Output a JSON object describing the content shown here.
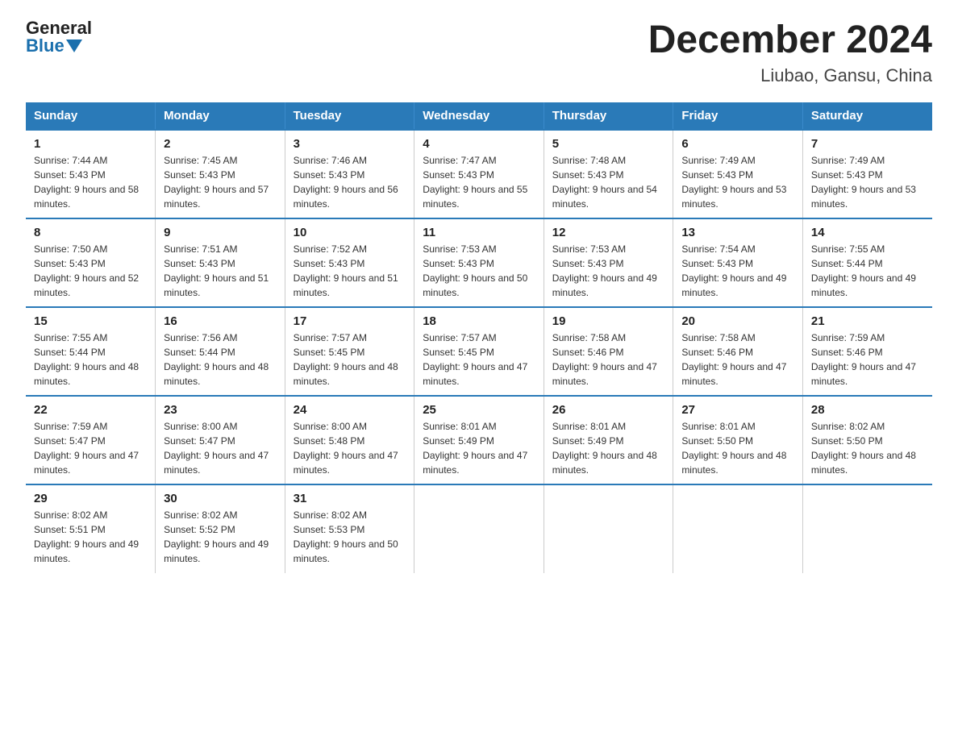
{
  "header": {
    "logo_general": "General",
    "logo_blue": "Blue",
    "month_title": "December 2024",
    "location": "Liubao, Gansu, China"
  },
  "weekdays": [
    "Sunday",
    "Monday",
    "Tuesday",
    "Wednesday",
    "Thursday",
    "Friday",
    "Saturday"
  ],
  "weeks": [
    [
      {
        "day": "1",
        "sunrise": "7:44 AM",
        "sunset": "5:43 PM",
        "daylight": "9 hours and 58 minutes."
      },
      {
        "day": "2",
        "sunrise": "7:45 AM",
        "sunset": "5:43 PM",
        "daylight": "9 hours and 57 minutes."
      },
      {
        "day": "3",
        "sunrise": "7:46 AM",
        "sunset": "5:43 PM",
        "daylight": "9 hours and 56 minutes."
      },
      {
        "day": "4",
        "sunrise": "7:47 AM",
        "sunset": "5:43 PM",
        "daylight": "9 hours and 55 minutes."
      },
      {
        "day": "5",
        "sunrise": "7:48 AM",
        "sunset": "5:43 PM",
        "daylight": "9 hours and 54 minutes."
      },
      {
        "day": "6",
        "sunrise": "7:49 AM",
        "sunset": "5:43 PM",
        "daylight": "9 hours and 53 minutes."
      },
      {
        "day": "7",
        "sunrise": "7:49 AM",
        "sunset": "5:43 PM",
        "daylight": "9 hours and 53 minutes."
      }
    ],
    [
      {
        "day": "8",
        "sunrise": "7:50 AM",
        "sunset": "5:43 PM",
        "daylight": "9 hours and 52 minutes."
      },
      {
        "day": "9",
        "sunrise": "7:51 AM",
        "sunset": "5:43 PM",
        "daylight": "9 hours and 51 minutes."
      },
      {
        "day": "10",
        "sunrise": "7:52 AM",
        "sunset": "5:43 PM",
        "daylight": "9 hours and 51 minutes."
      },
      {
        "day": "11",
        "sunrise": "7:53 AM",
        "sunset": "5:43 PM",
        "daylight": "9 hours and 50 minutes."
      },
      {
        "day": "12",
        "sunrise": "7:53 AM",
        "sunset": "5:43 PM",
        "daylight": "9 hours and 49 minutes."
      },
      {
        "day": "13",
        "sunrise": "7:54 AM",
        "sunset": "5:43 PM",
        "daylight": "9 hours and 49 minutes."
      },
      {
        "day": "14",
        "sunrise": "7:55 AM",
        "sunset": "5:44 PM",
        "daylight": "9 hours and 49 minutes."
      }
    ],
    [
      {
        "day": "15",
        "sunrise": "7:55 AM",
        "sunset": "5:44 PM",
        "daylight": "9 hours and 48 minutes."
      },
      {
        "day": "16",
        "sunrise": "7:56 AM",
        "sunset": "5:44 PM",
        "daylight": "9 hours and 48 minutes."
      },
      {
        "day": "17",
        "sunrise": "7:57 AM",
        "sunset": "5:45 PM",
        "daylight": "9 hours and 48 minutes."
      },
      {
        "day": "18",
        "sunrise": "7:57 AM",
        "sunset": "5:45 PM",
        "daylight": "9 hours and 47 minutes."
      },
      {
        "day": "19",
        "sunrise": "7:58 AM",
        "sunset": "5:46 PM",
        "daylight": "9 hours and 47 minutes."
      },
      {
        "day": "20",
        "sunrise": "7:58 AM",
        "sunset": "5:46 PM",
        "daylight": "9 hours and 47 minutes."
      },
      {
        "day": "21",
        "sunrise": "7:59 AM",
        "sunset": "5:46 PM",
        "daylight": "9 hours and 47 minutes."
      }
    ],
    [
      {
        "day": "22",
        "sunrise": "7:59 AM",
        "sunset": "5:47 PM",
        "daylight": "9 hours and 47 minutes."
      },
      {
        "day": "23",
        "sunrise": "8:00 AM",
        "sunset": "5:47 PM",
        "daylight": "9 hours and 47 minutes."
      },
      {
        "day": "24",
        "sunrise": "8:00 AM",
        "sunset": "5:48 PM",
        "daylight": "9 hours and 47 minutes."
      },
      {
        "day": "25",
        "sunrise": "8:01 AM",
        "sunset": "5:49 PM",
        "daylight": "9 hours and 47 minutes."
      },
      {
        "day": "26",
        "sunrise": "8:01 AM",
        "sunset": "5:49 PM",
        "daylight": "9 hours and 48 minutes."
      },
      {
        "day": "27",
        "sunrise": "8:01 AM",
        "sunset": "5:50 PM",
        "daylight": "9 hours and 48 minutes."
      },
      {
        "day": "28",
        "sunrise": "8:02 AM",
        "sunset": "5:50 PM",
        "daylight": "9 hours and 48 minutes."
      }
    ],
    [
      {
        "day": "29",
        "sunrise": "8:02 AM",
        "sunset": "5:51 PM",
        "daylight": "9 hours and 49 minutes."
      },
      {
        "day": "30",
        "sunrise": "8:02 AM",
        "sunset": "5:52 PM",
        "daylight": "9 hours and 49 minutes."
      },
      {
        "day": "31",
        "sunrise": "8:02 AM",
        "sunset": "5:53 PM",
        "daylight": "9 hours and 50 minutes."
      },
      null,
      null,
      null,
      null
    ]
  ]
}
